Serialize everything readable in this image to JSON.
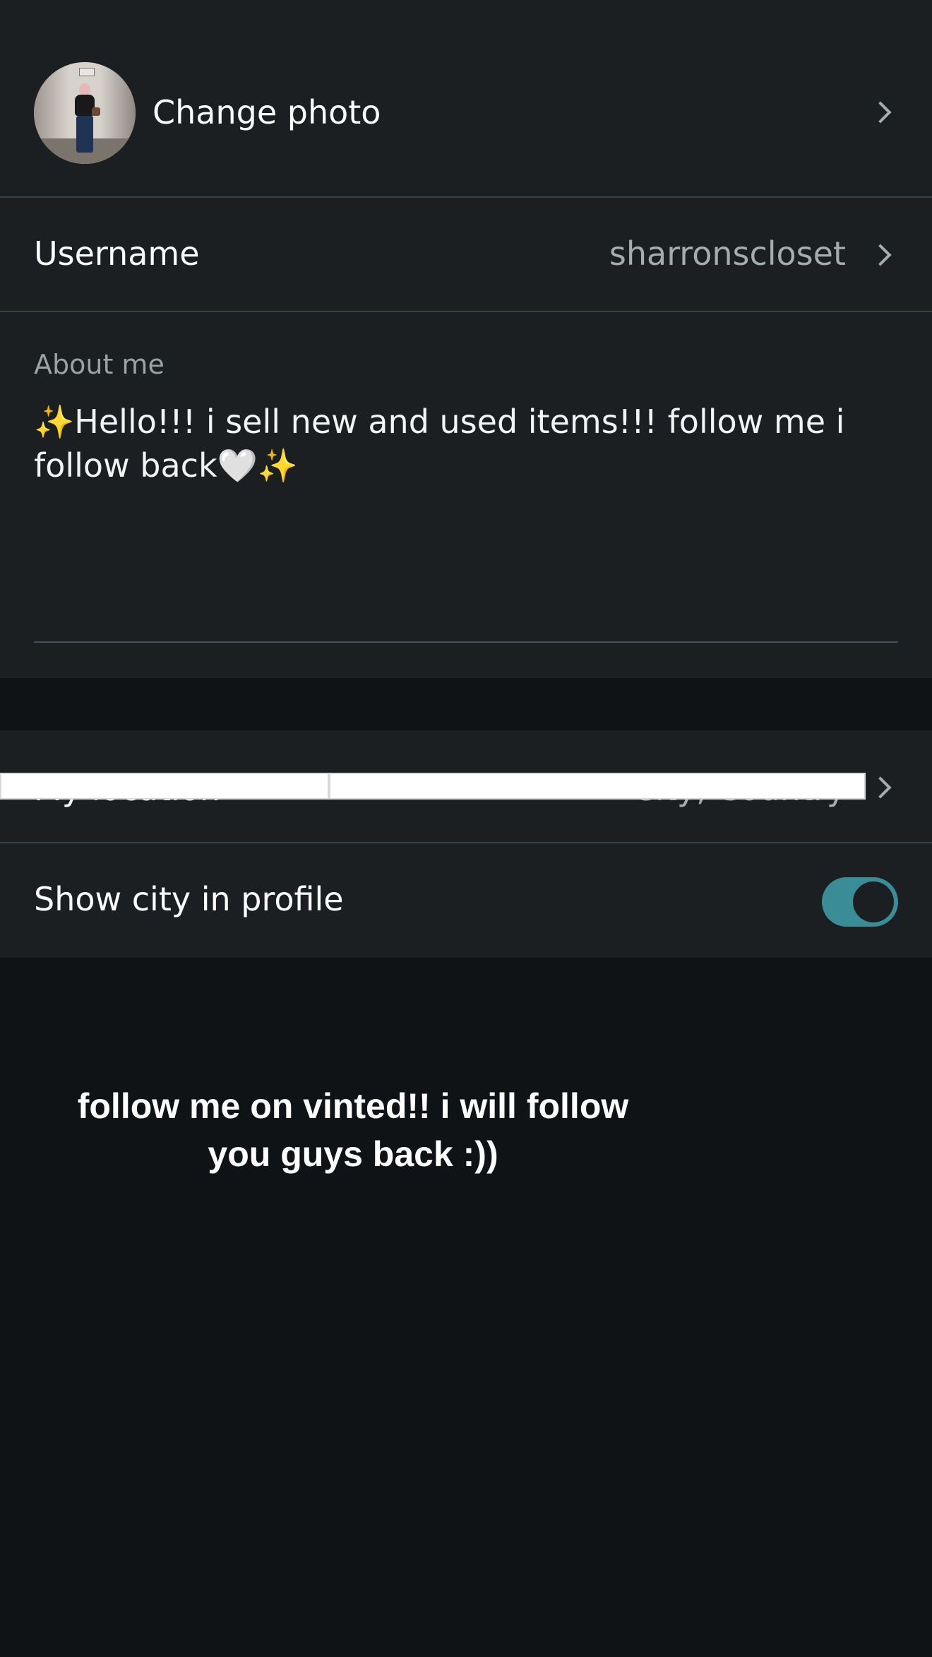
{
  "photo_row": {
    "label": "Change photo",
    "avatar_icon": "avatar"
  },
  "username_row": {
    "label": "Username",
    "value": "sharronscloset"
  },
  "about_section": {
    "heading": "About me",
    "text": "✨Hello!!! i sell new and used items!!! follow me i follow back🤍✨"
  },
  "location_row": {
    "label": "My location",
    "value": "City, Country"
  },
  "city_row": {
    "label": "Show city in profile",
    "toggle_on": true
  },
  "overlay": {
    "caption": "follow me on vinted!! i will follow you guys back :))"
  },
  "colors": {
    "background": "#0f1315",
    "section": "#1b1f22",
    "accent_toggle": "#3a8d97",
    "muted_text": "#a6abae"
  }
}
